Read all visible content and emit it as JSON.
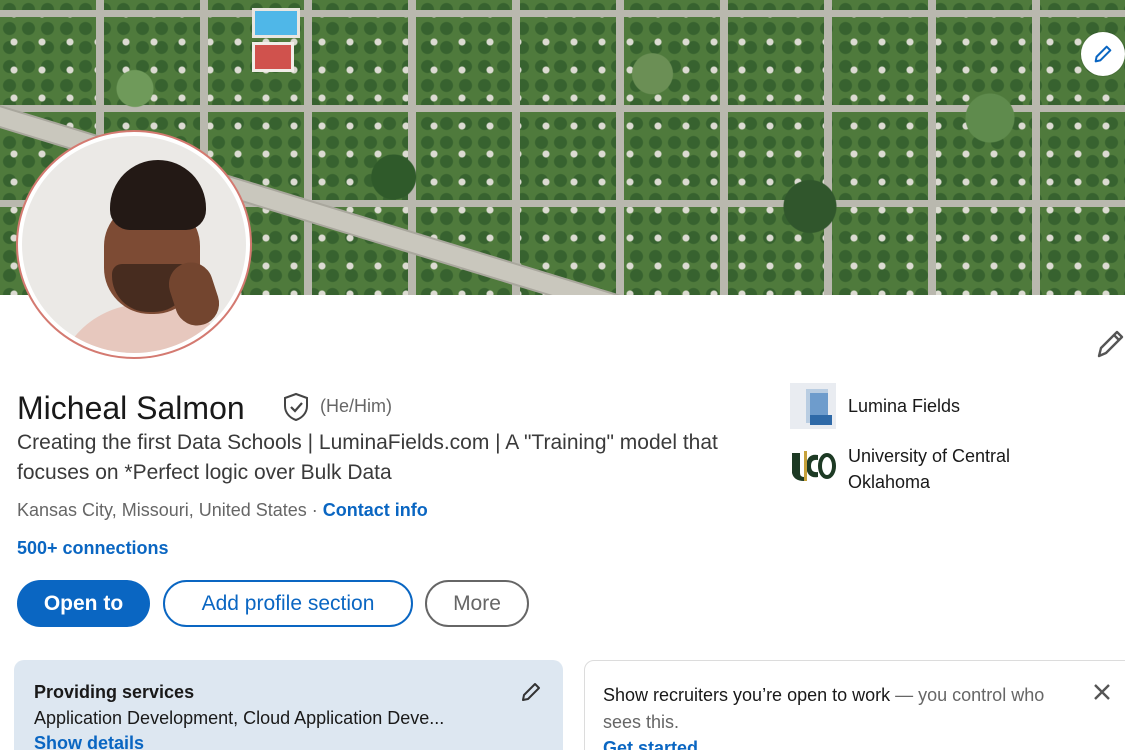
{
  "profile": {
    "name": "Micheal Salmon",
    "pronouns": "(He/Him)",
    "headline": "Creating the first Data Schools | LuminaFields.com | A \"Training\" model that focuses on *Perfect logic over Bulk Data",
    "location": "Kansas City, Missouri, United States",
    "separator": "·",
    "contact_label": "Contact info",
    "connections": "500+ connections"
  },
  "actions": {
    "open_to": "Open to",
    "add_section": "Add profile section",
    "more": "More"
  },
  "experience": {
    "company": "Lumina Fields",
    "school": "University of Central Oklahoma"
  },
  "services_card": {
    "title": "Providing services",
    "description": "Application Development, Cloud Application Deve...",
    "link": "Show details"
  },
  "recruiter_card": {
    "text_strong": "Show recruiters you’re open to work",
    "text_rest": " — you control who sees this.",
    "link": "Get started"
  },
  "colors": {
    "accent": "#0a66c2",
    "services_bg": "#dde7f1"
  },
  "icons": [
    "pencil-icon",
    "verified-shield-icon",
    "close-icon"
  ]
}
